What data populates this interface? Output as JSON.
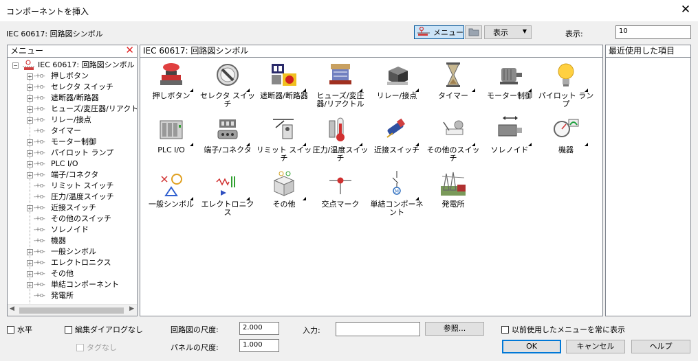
{
  "window": {
    "title": "コンポーネントを挿入",
    "close": "✕"
  },
  "subtitle": "IEC 60617: 回路図シンボル",
  "toolbar": {
    "menu_label": "メニュー",
    "view_label": "表示",
    "view_arrow": "▼",
    "display_label": "表示:",
    "display_value": "10"
  },
  "menu_panel": {
    "title": "メニュー",
    "close": "✕",
    "root": "IEC 60617: 回路図シンボル",
    "items": [
      {
        "label": "押しボタン",
        "expandable": true
      },
      {
        "label": "セレクタ スイッチ",
        "expandable": true
      },
      {
        "label": "遮断器/断路器",
        "expandable": true
      },
      {
        "label": "ヒューズ/変圧器/リアクトル",
        "expandable": true
      },
      {
        "label": "リレー/接点",
        "expandable": true
      },
      {
        "label": "タイマー",
        "expandable": false
      },
      {
        "label": "モーター制御",
        "expandable": true
      },
      {
        "label": "パイロット ランプ",
        "expandable": true
      },
      {
        "label": "PLC I/O",
        "expandable": true
      },
      {
        "label": "端子/コネクタ",
        "expandable": true
      },
      {
        "label": "リミット スイッチ",
        "expandable": false
      },
      {
        "label": "圧力/温度スイッチ",
        "expandable": false
      },
      {
        "label": "近接スイッチ",
        "expandable": true
      },
      {
        "label": "その他のスイッチ",
        "expandable": false
      },
      {
        "label": "ソレノイド",
        "expandable": false
      },
      {
        "label": "機器",
        "expandable": false
      },
      {
        "label": "一般シンボル",
        "expandable": true
      },
      {
        "label": "エレクトロニクス",
        "expandable": true
      },
      {
        "label": "その他",
        "expandable": true
      },
      {
        "label": "単結コンポーネント",
        "expandable": true
      },
      {
        "label": "発電所",
        "expandable": false
      }
    ]
  },
  "main_panel": {
    "title": "IEC 60617: 回路図シンボル",
    "icons": [
      {
        "label": "押しボタン",
        "icon": "pushbutton-icon"
      },
      {
        "label": "セレクタ スイッチ",
        "icon": "selector-switch-icon"
      },
      {
        "label": "遮断器/断路器",
        "icon": "breaker-icon"
      },
      {
        "label": "ヒューズ/変圧器/リアクトル",
        "icon": "fuse-transformer-icon"
      },
      {
        "label": "リレー/接点",
        "icon": "relay-icon"
      },
      {
        "label": "タイマー",
        "icon": "hourglass-icon"
      },
      {
        "label": "モーター制御",
        "icon": "motor-icon"
      },
      {
        "label": "パイロット ランプ",
        "icon": "lightbulb-icon"
      },
      {
        "label": "PLC I/O",
        "icon": "plc-icon"
      },
      {
        "label": "端子/コネクタ",
        "icon": "terminal-connector-icon"
      },
      {
        "label": "リミット スイッチ",
        "icon": "limit-switch-icon"
      },
      {
        "label": "圧力/温度スイッチ",
        "icon": "thermometer-icon"
      },
      {
        "label": "近接スイッチ",
        "icon": "proximity-switch-icon"
      },
      {
        "label": "その他のスイッチ",
        "icon": "other-switch-icon"
      },
      {
        "label": "ソレノイド",
        "icon": "solenoid-icon"
      },
      {
        "label": "機器",
        "icon": "gauge-icon"
      },
      {
        "label": "一般シンボル",
        "icon": "general-symbol-icon"
      },
      {
        "label": "エレクトロニクス",
        "icon": "electronics-icon"
      },
      {
        "label": "その他",
        "icon": "box-icon"
      },
      {
        "label": "交点マーク",
        "icon": "junction-dot-icon"
      },
      {
        "label": "単結コンポーネント",
        "icon": "single-line-icon"
      },
      {
        "label": "発電所",
        "icon": "power-plant-icon"
      }
    ]
  },
  "recent_panel": {
    "title": "最近使用した項目"
  },
  "footer": {
    "horizontal": "水平",
    "no_edit_dialog": "編集ダイアログなし",
    "no_tag": "タグなし",
    "circuit_scale_label": "回路図の尺度:",
    "circuit_scale_value": "2.000",
    "panel_scale_label": "パネルの尺度:",
    "panel_scale_value": "1.000",
    "input_label": "入力:",
    "input_value": "",
    "browse": "参照...",
    "always_show_prev": "以前使用したメニューを常に表示",
    "ok": "OK",
    "cancel": "キャンセル",
    "help": "ヘルプ"
  },
  "colors": {
    "accent": "#0078d7",
    "selected_bg": "#cce4f7",
    "close_red": "#e02020"
  }
}
